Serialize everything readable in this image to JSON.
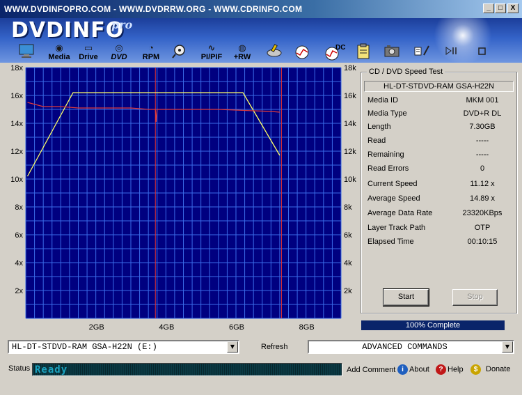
{
  "window": {
    "title": "WWW.DVDINFOPRO.COM  -  WWW.DVDRRW.ORG  -  WWW.CDRINFO.COM",
    "minimize": "_",
    "maximize": "□",
    "close": "X"
  },
  "banner": {
    "logo": "DVDINFO",
    "logo_suffix": "pro"
  },
  "toolbar": {
    "items": [
      {
        "label": "",
        "icon": "monitor-icon"
      },
      {
        "label": "Media",
        "icon": "media-icon"
      },
      {
        "label": "Drive",
        "icon": "drive-icon"
      },
      {
        "label": "DVD",
        "icon": "dvd-icon"
      },
      {
        "label": "RPM",
        "icon": "rpm-icon"
      },
      {
        "label": "",
        "icon": "magnifier-icon"
      },
      {
        "label": "PI/PIF",
        "icon": "pipif-icon"
      },
      {
        "label": "+RW",
        "icon": "rw-icon"
      },
      {
        "label": "",
        "icon": "disc-write-icon"
      },
      {
        "label": "",
        "icon": "disc-analyze-icon"
      },
      {
        "label": "DC",
        "icon": "dc-icon"
      },
      {
        "label": "",
        "icon": "clipboard-icon"
      },
      {
        "label": "",
        "icon": "camera-icon"
      },
      {
        "label": "",
        "icon": "notes-icon"
      },
      {
        "label": "",
        "icon": "play-pause-icon"
      },
      {
        "label": "",
        "icon": "stop-icon"
      }
    ]
  },
  "chart_data": {
    "type": "line",
    "title": "",
    "xlabel": "",
    "ylabel": "",
    "x_ticks": [
      "2GB",
      "4GB",
      "6GB",
      "8GB"
    ],
    "y_ticks_left": [
      "18x",
      "16x",
      "14x",
      "12x",
      "10x",
      "8x",
      "6x",
      "4x",
      "2x"
    ],
    "y_ticks_right": [
      "18k",
      "16k",
      "14k",
      "12k",
      "10k",
      "8k",
      "6k",
      "4k",
      "2k"
    ],
    "xlim": [
      0,
      9.0
    ],
    "ylim": [
      0,
      18
    ],
    "grid": true,
    "markers_gb": [
      3.7,
      7.3
    ],
    "series": [
      {
        "color": "#ffff66",
        "x": [
          0.05,
          1.35,
          6.2,
          7.25
        ],
        "y": [
          10.2,
          16.2,
          16.2,
          11.7
        ]
      },
      {
        "color": "#e03a3a",
        "x": [
          0.05,
          0.5,
          1.0,
          1.5,
          2.0,
          2.5,
          3.0,
          3.5,
          3.7,
          3.72,
          3.75,
          4.0,
          4.5,
          5.0,
          5.5,
          6.0,
          6.5,
          7.0,
          7.25
        ],
        "y": [
          15.5,
          15.2,
          15.2,
          15.1,
          15.1,
          15.1,
          15.1,
          15.0,
          15.0,
          14.1,
          15.0,
          15.0,
          15.0,
          15.0,
          15.0,
          14.95,
          14.9,
          14.85,
          14.8
        ]
      }
    ]
  },
  "speed_test": {
    "group_title": "CD / DVD Speed Test",
    "drive": "HL-DT-STDVD-RAM GSA-H22N",
    "rows": [
      {
        "key": "Media ID",
        "value": "MKM    001"
      },
      {
        "key": "Media Type",
        "value": "DVD+R DL"
      },
      {
        "key": "Length",
        "value": "7.30GB"
      },
      {
        "key": "Read",
        "value": "-----"
      },
      {
        "key": "Remaining",
        "value": "-----"
      },
      {
        "key": "Read Errors",
        "value": "0"
      },
      {
        "key": "Current Speed",
        "value": "11.12 x"
      },
      {
        "key": "Average Speed",
        "value": "14.89 x"
      },
      {
        "key": "Average Data Rate",
        "value": "23320KBps"
      },
      {
        "key": "Layer Track Path",
        "value": "OTP"
      },
      {
        "key": "Elapsed Time",
        "value": "00:10:15"
      }
    ],
    "start": "Start",
    "stop": "Stop",
    "progress_text": "100% Complete",
    "progress": 1.0
  },
  "bottom": {
    "drive_select": "HL-DT-STDVD-RAM GSA-H22N (E:)",
    "refresh": "Refresh",
    "commands_select": "ADVANCED COMMANDS",
    "status_label": "Status",
    "status_text": "Ready",
    "add_comment": "Add Comment",
    "about": "About",
    "help": "Help",
    "donate": "Donate"
  }
}
